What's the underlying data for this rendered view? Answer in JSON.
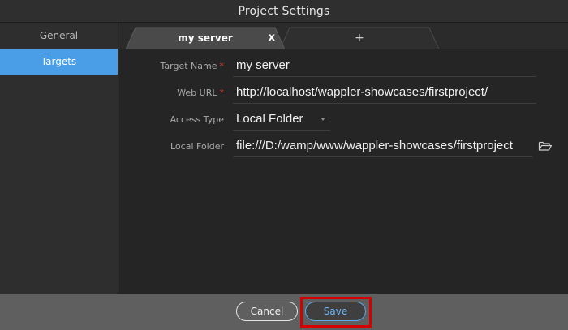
{
  "window": {
    "title": "Project Settings"
  },
  "sidebar": {
    "items": [
      {
        "label": "General",
        "active": false
      },
      {
        "label": "Targets",
        "active": true
      }
    ]
  },
  "tabs": [
    {
      "label": "my server",
      "close_label": "x",
      "active": true
    },
    {
      "label": "+",
      "active": false
    }
  ],
  "form": {
    "target_name": {
      "label": "Target Name",
      "required_mark": "*",
      "value": "my server"
    },
    "web_url": {
      "label": "Web URL",
      "required_mark": "*",
      "value": "http://localhost/wappler-showcases/firstproject/"
    },
    "access_type": {
      "label": "Access Type",
      "value": "Local Folder"
    },
    "local_folder": {
      "label": "Local Folder",
      "value": "file:///D:/wamp/www/wappler-showcases/firstproject",
      "icon": "folder-open-icon"
    }
  },
  "footer": {
    "cancel_label": "Cancel",
    "save_label": "Save"
  },
  "colors": {
    "accent": "#4a9ee8",
    "required": "#e0453a",
    "highlight": "#d40000"
  }
}
